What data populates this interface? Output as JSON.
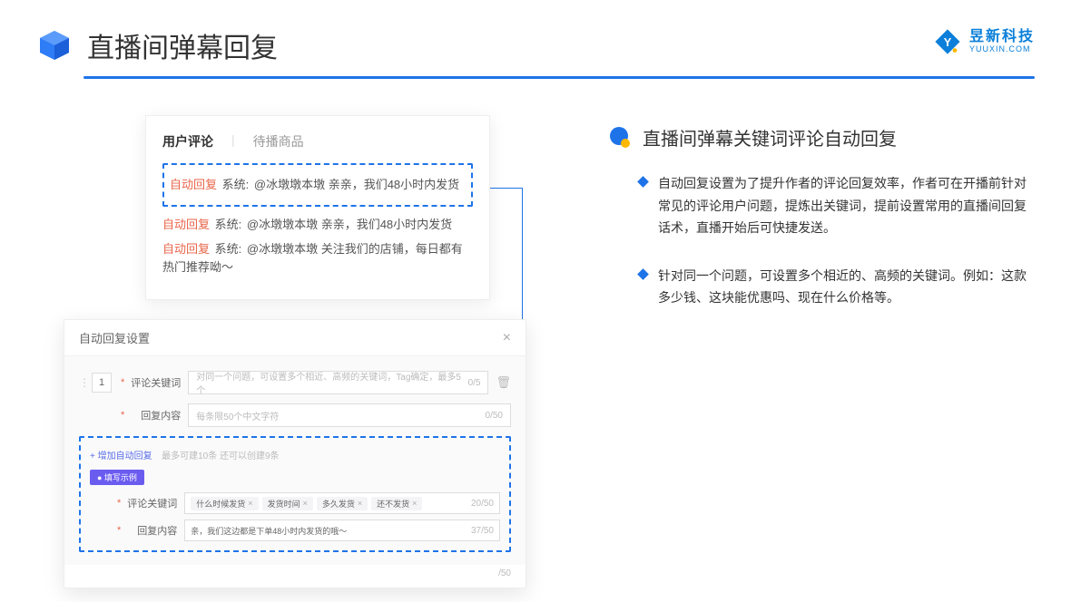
{
  "header": {
    "title": "直播间弹幕回复",
    "brand_cn": "昱新科技",
    "brand_en": "YUUXIN.COM"
  },
  "card1": {
    "tab_active": "用户评论",
    "tab_inactive": "待播商品",
    "highlight_tag": "自动回复",
    "highlight_sys": "系统:",
    "highlight_text": "@冰墩墩本墩 亲亲，我们48小时内发货",
    "row2_tag": "自动回复",
    "row2_sys": "系统:",
    "row2_text": "@冰墩墩本墩 亲亲，我们48小时内发货",
    "row3_tag": "自动回复",
    "row3_sys": "系统:",
    "row3_text": "@冰墩墩本墩 关注我们的店铺，每日都有热门推荐呦～"
  },
  "card2": {
    "title": "自动回复设置",
    "num": "1",
    "kw_label": "评论关键词",
    "kw_placeholder": "对同一个问题，可设置多个相近、高频的关键词，Tag确定，最多5个",
    "kw_count": "0/5",
    "content_label": "回复内容",
    "content_placeholder": "每条限50个中文字符",
    "content_count": "0/50",
    "add_link": "+ 增加自动回复",
    "add_hint": "最多可建10条 还可以创建9条",
    "badge": "● 填写示例",
    "ex_kw_label": "评论关键词",
    "ex_tag1": "什么时候发货",
    "ex_tag2": "发货时间",
    "ex_tag3": "多久发货",
    "ex_tag4": "还不发货",
    "ex_kw_count": "20/50",
    "ex_content_label": "回复内容",
    "ex_content_value": "亲，我们这边都是下单48小时内发货的哦～",
    "ex_content_count": "37/50",
    "footer_count": "/50"
  },
  "right": {
    "section_title": "直播间弹幕关键词评论自动回复",
    "bullet1": "自动回复设置为了提升作者的评论回复效率，作者可在开播前针对常见的评论用户问题，提炼出关键词，提前设置常用的直播间回复话术，直播开始后可快捷发送。",
    "bullet2": "针对同一个问题，可设置多个相近的、高频的关键词。例如：这款多少钱、这块能优惠吗、现在什么价格等。"
  }
}
